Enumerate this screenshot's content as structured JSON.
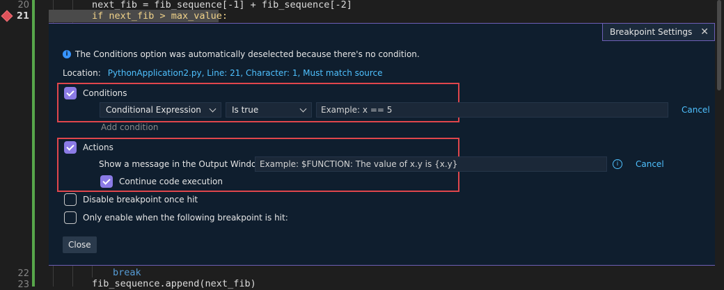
{
  "editor": {
    "lines": [
      {
        "num": "20",
        "code": "next_fib = fib_sequence[-1] + fib_sequence[-2]"
      },
      {
        "num": "21",
        "code": "if next_fib > max_value:"
      },
      {
        "num": "22",
        "code": "break"
      },
      {
        "num": "23",
        "code": "fib_sequence.append(next_fib)"
      }
    ]
  },
  "panel": {
    "tab_title": "Breakpoint Settings",
    "info_message": "The Conditions option was automatically deselected because there's no condition.",
    "location_label": "Location:",
    "location_value": "PythonApplication2.py, Line: 21, Character: 1, Must match source",
    "conditions": {
      "label": "Conditions",
      "checked": true,
      "type_selected": "Conditional Expression",
      "operator_selected": "Is true",
      "expression_placeholder": "Example: x == 5",
      "cancel_label": "Cancel",
      "add_condition_label": "Add condition"
    },
    "actions": {
      "label": "Actions",
      "checked": true,
      "message_label": "Show a message in the Output Window:",
      "message_placeholder": "Example: $FUNCTION: The value of x.y is {x.y}",
      "cancel_label": "Cancel",
      "continue_label": "Continue code execution",
      "continue_checked": true
    },
    "disable_once_hit_label": "Disable breakpoint once hit",
    "only_enable_label": "Only enable when the following breakpoint is hit:",
    "close_label": "Close"
  },
  "colors": {
    "accent": "#8b7be6",
    "highlight_box": "#e0464c",
    "link": "#4fc1ff",
    "panel_bg": "#0f1e2e",
    "change_bar": "#57a64a"
  }
}
